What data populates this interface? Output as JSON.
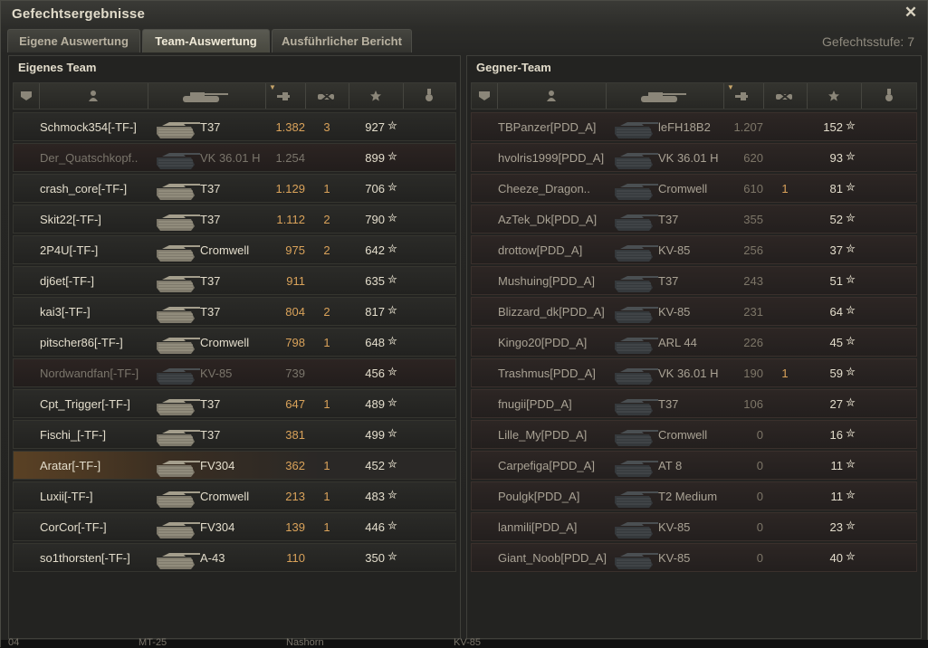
{
  "window": {
    "title": "Gefechtsergebnisse",
    "close_icon": "close-icon"
  },
  "tabs": [
    {
      "label": "Eigene Auswertung",
      "active": false
    },
    {
      "label": "Team-Auswertung",
      "active": true
    },
    {
      "label": "Ausführlicher Bericht",
      "active": false
    }
  ],
  "battle_level": "Gefechtsstufe: 7",
  "own_team": {
    "title": "Eigenes Team",
    "rows": [
      {
        "player": "Schmock354[-TF-]",
        "tank": "T37",
        "damage": "1.382",
        "kills": "3",
        "xp": "927",
        "dead": false,
        "highlight": false
      },
      {
        "player": "Der_Quatschkopf..",
        "tank": "VK 36.01 H",
        "damage": "1.254",
        "kills": "",
        "xp": "899",
        "dead": true,
        "highlight": false
      },
      {
        "player": "crash_core[-TF-]",
        "tank": "T37",
        "damage": "1.129",
        "kills": "1",
        "xp": "706",
        "dead": false,
        "highlight": false
      },
      {
        "player": "Skit22[-TF-]",
        "tank": "T37",
        "damage": "1.112",
        "kills": "2",
        "xp": "790",
        "dead": false,
        "highlight": false
      },
      {
        "player": "2P4U[-TF-]",
        "tank": "Cromwell",
        "damage": "975",
        "kills": "2",
        "xp": "642",
        "dead": false,
        "highlight": false
      },
      {
        "player": "dj6et[-TF-]",
        "tank": "T37",
        "damage": "911",
        "kills": "",
        "xp": "635",
        "dead": false,
        "highlight": false
      },
      {
        "player": "kai3[-TF-]",
        "tank": "T37",
        "damage": "804",
        "kills": "2",
        "xp": "817",
        "dead": false,
        "highlight": false
      },
      {
        "player": "pitscher86[-TF-]",
        "tank": "Cromwell",
        "damage": "798",
        "kills": "1",
        "xp": "648",
        "dead": false,
        "highlight": false
      },
      {
        "player": "Nordwandfan[-TF-]",
        "tank": "KV-85",
        "damage": "739",
        "kills": "",
        "xp": "456",
        "dead": true,
        "highlight": false
      },
      {
        "player": "Cpt_Trigger[-TF-]",
        "tank": "T37",
        "damage": "647",
        "kills": "1",
        "xp": "489",
        "dead": false,
        "highlight": false
      },
      {
        "player": "Fischi_[-TF-]",
        "tank": "T37",
        "damage": "381",
        "kills": "",
        "xp": "499",
        "dead": false,
        "highlight": false
      },
      {
        "player": "Aratar[-TF-]",
        "tank": "FV304",
        "damage": "362",
        "kills": "1",
        "xp": "452",
        "dead": false,
        "highlight": true
      },
      {
        "player": "Luxii[-TF-]",
        "tank": "Cromwell",
        "damage": "213",
        "kills": "1",
        "xp": "483",
        "dead": false,
        "highlight": false
      },
      {
        "player": "CorCor[-TF-]",
        "tank": "FV304",
        "damage": "139",
        "kills": "1",
        "xp": "446",
        "dead": false,
        "highlight": false
      },
      {
        "player": "so1thorsten[-TF-]",
        "tank": "A-43",
        "damage": "110",
        "kills": "",
        "xp": "350",
        "dead": false,
        "highlight": false
      }
    ]
  },
  "enemy_team": {
    "title": "Gegner-Team",
    "rows": [
      {
        "player": "TBPanzer[PDD_A]",
        "tank": "leFH18B2",
        "damage": "1.207",
        "kills": "",
        "xp": "152"
      },
      {
        "player": "hvolris1999[PDD_A]",
        "tank": "VK 36.01 H",
        "damage": "620",
        "kills": "",
        "xp": "93"
      },
      {
        "player": "Cheeze_Dragon..",
        "tank": "Cromwell",
        "damage": "610",
        "kills": "1",
        "xp": "81"
      },
      {
        "player": "AzTek_Dk[PDD_A]",
        "tank": "T37",
        "damage": "355",
        "kills": "",
        "xp": "52"
      },
      {
        "player": "drottow[PDD_A]",
        "tank": "KV-85",
        "damage": "256",
        "kills": "",
        "xp": "37"
      },
      {
        "player": "Mushuing[PDD_A]",
        "tank": "T37",
        "damage": "243",
        "kills": "",
        "xp": "51"
      },
      {
        "player": "Blizzard_dk[PDD_A]",
        "tank": "KV-85",
        "damage": "231",
        "kills": "",
        "xp": "64"
      },
      {
        "player": "Kingo20[PDD_A]",
        "tank": "ARL 44",
        "damage": "226",
        "kills": "",
        "xp": "45"
      },
      {
        "player": "Trashmus[PDD_A]",
        "tank": "VK 36.01 H",
        "damage": "190",
        "kills": "1",
        "xp": "59"
      },
      {
        "player": "fnugii[PDD_A]",
        "tank": "T37",
        "damage": "106",
        "kills": "",
        "xp": "27"
      },
      {
        "player": "Lille_My[PDD_A]",
        "tank": "Cromwell",
        "damage": "0",
        "kills": "",
        "xp": "16"
      },
      {
        "player": "Carpefiga[PDD_A]",
        "tank": "AT 8",
        "damage": "0",
        "kills": "",
        "xp": "11"
      },
      {
        "player": "Poulgk[PDD_A]",
        "tank": "T2 Medium",
        "damage": "0",
        "kills": "",
        "xp": "11"
      },
      {
        "player": "lanmili[PDD_A]",
        "tank": "KV-85",
        "damage": "0",
        "kills": "",
        "xp": "23"
      },
      {
        "player": "Giant_Noob[PDD_A]",
        "tank": "KV-85",
        "damage": "0",
        "kills": "",
        "xp": "40"
      }
    ]
  },
  "columns": [
    "squad-icon",
    "player-icon",
    "tank-icon",
    "damage-icon",
    "kills-icon",
    "xp-star-icon",
    "medal-icon"
  ],
  "star_glyph": "✮",
  "background_footer": [
    "04",
    "MT-25",
    "Nashorn",
    "KV-85"
  ]
}
